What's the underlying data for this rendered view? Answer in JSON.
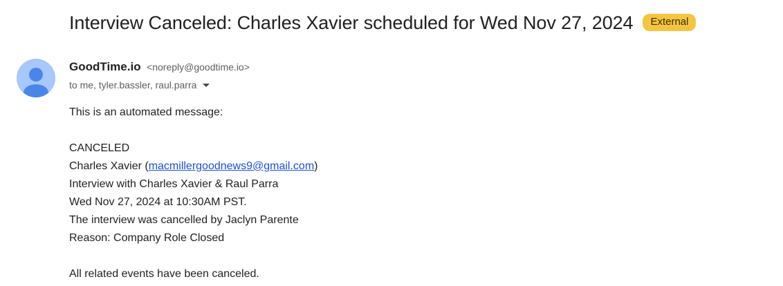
{
  "email": {
    "subject": "Interview Canceled: Charles Xavier scheduled for Wed Nov 27, 2024",
    "badge": "External",
    "sender": {
      "name": "GoodTime.io",
      "email": "<noreply@goodtime.io>"
    },
    "recipients": "to me, tyler.bassler, raul.parra",
    "body": {
      "intro": "This is an automated message:",
      "status": "CANCELED",
      "candidate_name_prefix": "Charles Xavier (",
      "candidate_email": "macmillergoodnews9@gmail.com",
      "candidate_name_suffix": ")",
      "interview_line": "Interview with Charles Xavier & Raul Parra",
      "datetime_line": "Wed Nov 27, 2024 at 10:30AM PST.",
      "cancelled_by_line": "The interview was cancelled by Jaclyn Parente",
      "reason_line": "Reason: Company Role Closed",
      "events_line": "All related events have been canceled."
    }
  },
  "colors": {
    "badge_bg": "#f5c542",
    "avatar_bg": "#a8c7fa",
    "avatar_fg": "#4a86e8",
    "link": "#1a4fd6"
  },
  "icons": {
    "avatar": "person-avatar-icon",
    "recipients_dropdown": "chevron-down-icon"
  }
}
